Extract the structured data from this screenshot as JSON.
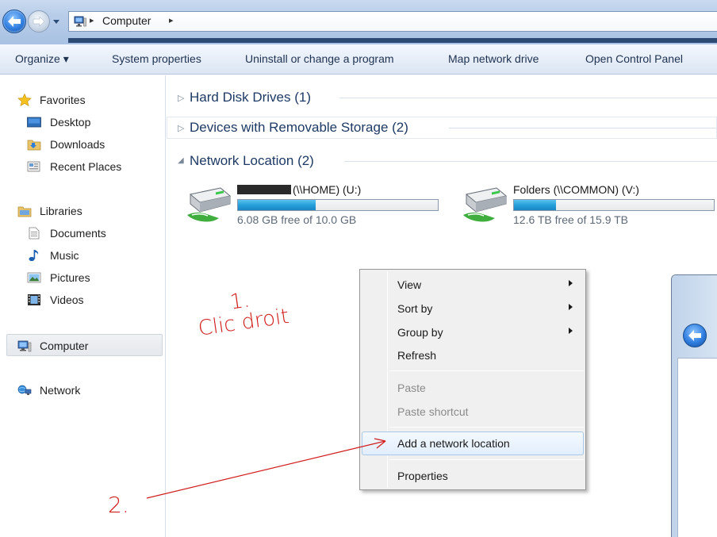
{
  "address": {
    "location": "Computer",
    "separator": "▸"
  },
  "toolbar": {
    "organize": "Organize ▾",
    "system_properties": "System properties",
    "uninstall": "Uninstall or change a program",
    "map_drive": "Map network drive",
    "control_panel": "Open Control Panel"
  },
  "nav": {
    "favorites": "Favorites",
    "desktop": "Desktop",
    "downloads": "Downloads",
    "recent_places": "Recent Places",
    "libraries": "Libraries",
    "documents": "Documents",
    "music": "Music",
    "pictures": "Pictures",
    "videos": "Videos",
    "computer": "Computer",
    "network": "Network"
  },
  "groups": {
    "hard_disk": "Hard Disk Drives (1)",
    "removable": "Devices with Removable Storage (2)",
    "network": "Network Location (2)",
    "collapsed_arrow": "▷",
    "expanded_arrow": "◢"
  },
  "drives": [
    {
      "name": "(\\\\HOME) (U:)",
      "free": "6.08 GB free of 10.0 GB",
      "used_fraction": 0.39
    },
    {
      "name": "Folders (\\\\COMMON) (V:)",
      "free": "12.6 TB free of 15.9 TB",
      "used_fraction": 0.21
    }
  ],
  "context_menu": {
    "view": "View",
    "sort_by": "Sort by",
    "group_by": "Group by",
    "refresh": "Refresh",
    "paste": "Paste",
    "paste_shortcut": "Paste shortcut",
    "add_network_location": "Add a network location",
    "properties": "Properties"
  },
  "annotations": {
    "step1": "1.",
    "step1_text": "Clic droit",
    "step2": "2.",
    "color": "#d21e1e"
  },
  "colors": {
    "accent": "#26a0da",
    "group_title": "#1e3a64"
  }
}
